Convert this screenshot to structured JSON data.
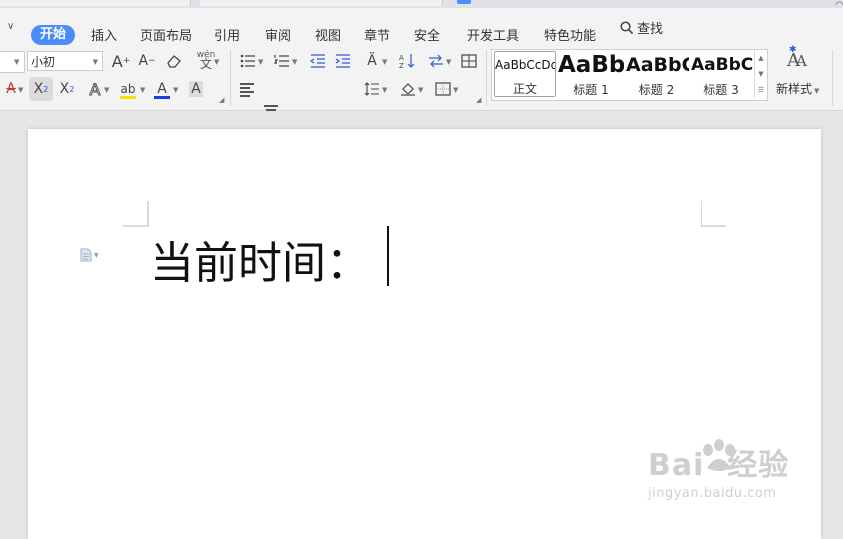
{
  "menu": {
    "items": [
      "插入",
      "页面布局",
      "引用",
      "审阅",
      "视图",
      "章节",
      "安全",
      "开发工具",
      "特色功能"
    ],
    "active": "开始",
    "search": "查找"
  },
  "ribbon": {
    "font_size": "小初",
    "pinyin_icon_text": "wén"
  },
  "styles": [
    {
      "preview": "AaBbCcDd",
      "label": "正文"
    },
    {
      "preview": "AaBb",
      "label": "标题 1"
    },
    {
      "preview": "AaBbC",
      "label": "标题 2"
    },
    {
      "preview": "AaBbCc",
      "label": "标题 3"
    }
  ],
  "new_style_label": "新样式",
  "document": {
    "text": "当前时间："
  },
  "watermark": {
    "brand": "Bai  经验",
    "url": "jingyan.baidu.com"
  },
  "colors": {
    "accent": "#4a8df8",
    "highlight": "#f5e100",
    "font_color": "#1a3fd6"
  }
}
